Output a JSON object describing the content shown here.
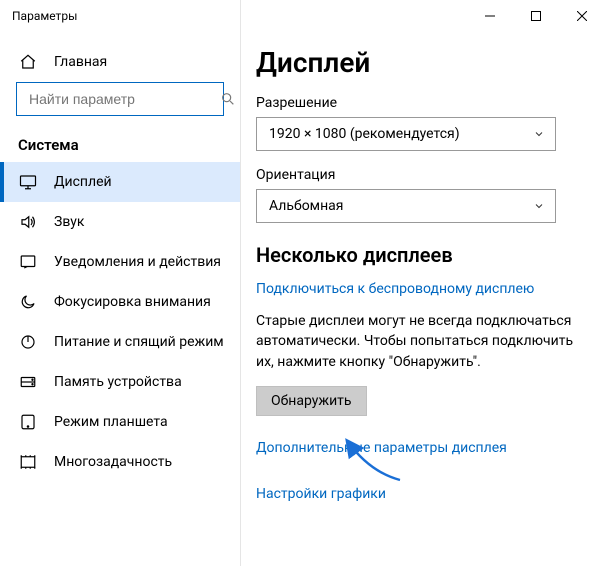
{
  "window": {
    "title": "Параметры"
  },
  "sidebar": {
    "home_label": "Главная",
    "search_placeholder": "Найти параметр",
    "section_label": "Система",
    "items": [
      {
        "label": "Дисплей"
      },
      {
        "label": "Звук"
      },
      {
        "label": "Уведомления и действия"
      },
      {
        "label": "Фокусировка внимания"
      },
      {
        "label": "Питание и спящий режим"
      },
      {
        "label": "Память устройства"
      },
      {
        "label": "Режим планшета"
      },
      {
        "label": "Многозадачность"
      }
    ]
  },
  "main": {
    "title": "Дисплей",
    "resolution": {
      "label": "Разрешение",
      "value": "1920 × 1080 (рекомендуется)"
    },
    "orientation": {
      "label": "Ориентация",
      "value": "Альбомная"
    },
    "multi": {
      "heading": "Несколько дисплеев",
      "wireless_link": "Подключиться к беспроводному дисплею",
      "hint": "Старые дисплеи могут не всегда подключаться автоматически. Чтобы попытаться подключить их, нажмите кнопку \"Обнаружить\".",
      "detect_button": "Обнаружить",
      "advanced_link": "Дополнительные параметры дисплея",
      "graphics_link": "Настройки графики"
    }
  }
}
